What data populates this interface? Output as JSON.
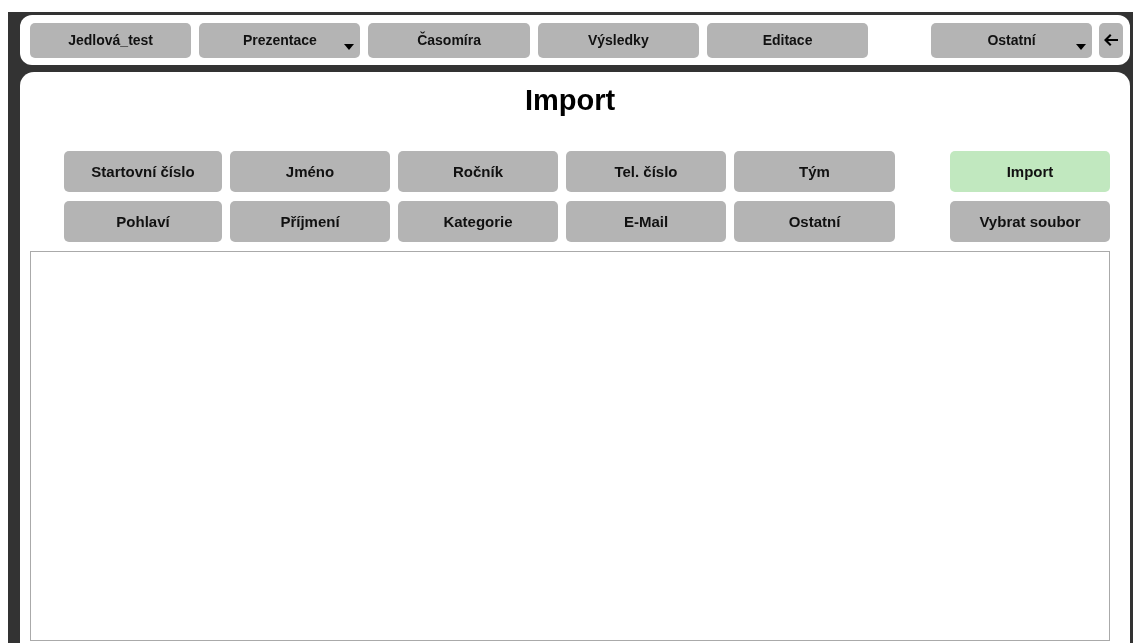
{
  "nav": [
    {
      "label": "Jedlová_test",
      "dropdown": false
    },
    {
      "label": "Prezentace",
      "dropdown": true
    },
    {
      "label": "Časomíra",
      "dropdown": false
    },
    {
      "label": "Výsledky",
      "dropdown": false
    },
    {
      "label": "Editace",
      "dropdown": false
    },
    {
      "label": "Ostatní",
      "dropdown": true
    }
  ],
  "title": "Import",
  "fields": [
    [
      "Startovní číslo",
      "Jméno",
      "Ročník",
      "Tel. číslo",
      "Tým"
    ],
    [
      "Pohlaví",
      "Příjmení",
      "Kategorie",
      "E-Mail",
      "Ostatní"
    ]
  ],
  "actions": [
    {
      "label": "Import",
      "kind": "primary"
    },
    {
      "label": "Vybrat soubor",
      "kind": "plain"
    }
  ]
}
